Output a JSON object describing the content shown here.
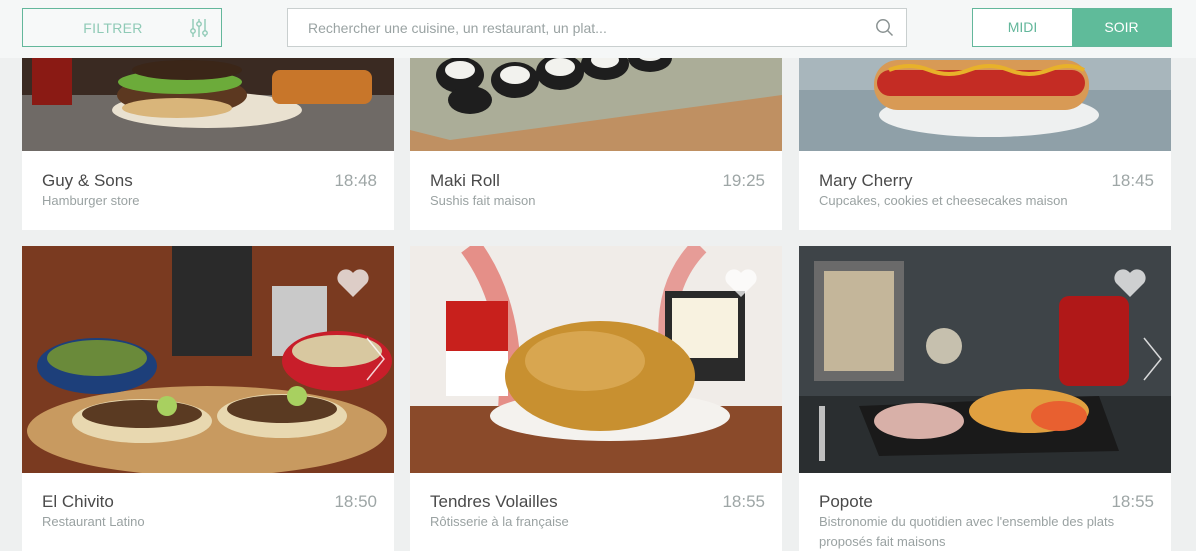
{
  "filter": {
    "label": "FILTRER",
    "icon": "sliders-icon"
  },
  "search": {
    "placeholder": "Rechercher une cuisine, un restaurant, un plat...",
    "value": "",
    "icon": "search-icon"
  },
  "service": {
    "options": [
      "MIDI",
      "SOIR"
    ],
    "selected": "SOIR"
  },
  "colors": {
    "accent": "#5fbb9a",
    "background": "#eef0f0"
  },
  "restaurants": [
    {
      "name": "Guy & Sons",
      "time": "18:48",
      "description": "Hamburger store"
    },
    {
      "name": "Maki Roll",
      "time": "19:25",
      "description": "Sushis fait maison"
    },
    {
      "name": "Mary Cherry",
      "time": "18:45",
      "description": "Cupcakes, cookies et cheesecakes maison"
    },
    {
      "name": "El Chivito",
      "time": "18:50",
      "description": "Restaurant Latino"
    },
    {
      "name": "Tendres Volailles",
      "time": "18:55",
      "description": "Rôtisserie à la française"
    },
    {
      "name": "Popote",
      "time": "18:55",
      "description": "Bistronomie du quotidien avec l'ensemble des plats proposés fait maisons"
    }
  ]
}
